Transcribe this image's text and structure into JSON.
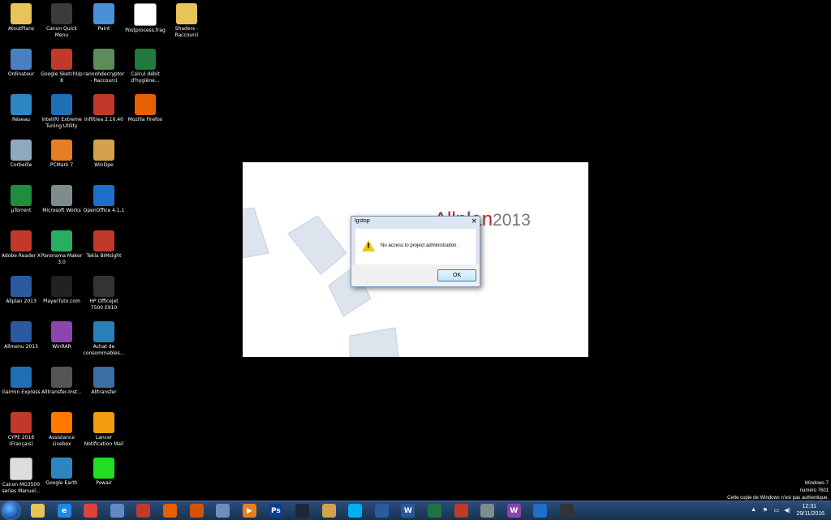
{
  "desktop": {
    "icons": [
      {
        "label": "AtoutPlans",
        "icon": "folder-icon",
        "color": "#e8c35a"
      },
      {
        "label": "Canon Quick Menu",
        "icon": "canon-icon",
        "color": "#3b3b3b"
      },
      {
        "label": "Paint",
        "icon": "paint-icon",
        "color": "#4a90d9"
      },
      {
        "label": "Postprocess.frag",
        "icon": "file-icon",
        "color": "#ffffff"
      },
      {
        "label": "Shaders - Raccourci",
        "icon": "folder-icon",
        "color": "#e8c35a"
      },
      {
        "label": "Ordinateur",
        "icon": "computer-icon",
        "color": "#4a7fc1"
      },
      {
        "label": "Google SketchUp 8",
        "icon": "sketchup-icon",
        "color": "#c0392b"
      },
      {
        "label": "rannohdecryptor - Raccourci",
        "icon": "app-icon",
        "color": "#5b8c5a"
      },
      {
        "label": "Calcul débit d'hygiène...",
        "icon": "excel-icon",
        "color": "#1f7a3b"
      },
      {
        "label": "Réseau",
        "icon": "network-icon",
        "color": "#2e86c1"
      },
      {
        "label": "Intel(R) Extreme Tuning Utility",
        "icon": "intel-icon",
        "color": "#1f6fb5"
      },
      {
        "label": "Infiltrea 2.10.40",
        "icon": "infiltrea-icon",
        "color": "#c0392b"
      },
      {
        "label": "Mozilla Firefox",
        "icon": "firefox-icon",
        "color": "#e66000"
      },
      {
        "label": "Corbeille",
        "icon": "recycle-bin-icon",
        "color": "#8fa7bf"
      },
      {
        "label": "PCMark 7",
        "icon": "pcmark-icon",
        "color": "#e67e22"
      },
      {
        "label": "WinDpe",
        "icon": "house-icon",
        "color": "#d4a24c"
      },
      {
        "label": "µTorrent",
        "icon": "utorrent-icon",
        "color": "#1e8e3e"
      },
      {
        "label": "Microsoft Works",
        "icon": "works-icon",
        "color": "#7f8c8d"
      },
      {
        "label": "OpenOffice 4.1.1",
        "icon": "openoffice-icon",
        "color": "#1e6fc9"
      },
      {
        "label": "Adobe Reader X",
        "icon": "adobe-icon",
        "color": "#c0392b"
      },
      {
        "label": "Panorama Maker 3.0",
        "icon": "panorama-icon",
        "color": "#27ae60"
      },
      {
        "label": "Tekla BIMsight",
        "icon": "tekla-icon",
        "color": "#c0392b"
      },
      {
        "label": "Allplan 2013",
        "icon": "allplan-icon",
        "color": "#2c5aa0"
      },
      {
        "label": "PlayerTuto.com",
        "icon": "player-icon",
        "color": "#222222"
      },
      {
        "label": "HP Officejet 7500 E910",
        "icon": "printer-icon",
        "color": "#333333"
      },
      {
        "label": "Allmenu 2013",
        "icon": "allmenu-icon",
        "color": "#2c5aa0"
      },
      {
        "label": "WinRAR",
        "icon": "winrar-icon",
        "color": "#8e44ad"
      },
      {
        "label": "Achat de consommables...",
        "icon": "shop-icon",
        "color": "#2980b9"
      },
      {
        "label": "Garmin Express",
        "icon": "garmin-icon",
        "color": "#1f6fb5"
      },
      {
        "label": "Alltransfer-Inst...",
        "icon": "laptop-icon",
        "color": "#555555"
      },
      {
        "label": "Alltransfer",
        "icon": "transfer-icon",
        "color": "#3b6ea5"
      },
      {
        "label": "CYPE 2016 (Français)",
        "icon": "cype-icon",
        "color": "#c0392b"
      },
      {
        "label": "Assistance Livebox",
        "icon": "livebox-icon",
        "color": "#ff7900"
      },
      {
        "label": "Lancer Notification Mail",
        "icon": "notification-icon",
        "color": "#f39c12"
      },
      {
        "label": "Canon MG3500 series Manuel...",
        "icon": "manual-icon",
        "color": "#dddddd"
      },
      {
        "label": "Google Earth",
        "icon": "google-earth-icon",
        "color": "#2e86c1"
      },
      {
        "label": "Powair",
        "icon": "powair-icon",
        "color": "#22dd22"
      }
    ]
  },
  "splash": {
    "logo_main": "Allplan",
    "logo_year": "2013"
  },
  "dialog": {
    "title": "lgstop",
    "close": "×",
    "message": "No access to project administration.",
    "ok_label": "OK"
  },
  "watermark": {
    "line1": "Windows 7",
    "line2": "numéro 7601",
    "line3": "Cette copie de Windows n'est pas authentique."
  },
  "taskbar": {
    "items": [
      {
        "icon": "explorer-icon",
        "color": "#e8c35a",
        "glyph": ""
      },
      {
        "icon": "internet-explorer-icon",
        "color": "#1e88e5",
        "glyph": "e"
      },
      {
        "icon": "chrome-icon",
        "color": "#db4437",
        "glyph": ""
      },
      {
        "icon": "mail-icon",
        "color": "#5d8ac4",
        "glyph": ""
      },
      {
        "icon": "antivirus-icon",
        "color": "#c0392b",
        "glyph": ""
      },
      {
        "icon": "firefox-icon",
        "color": "#e66000",
        "glyph": ""
      },
      {
        "icon": "paint-icon",
        "color": "#d35400",
        "glyph": ""
      },
      {
        "icon": "window-icon",
        "color": "#6c8ebf",
        "glyph": ""
      },
      {
        "icon": "media-player-icon",
        "color": "#e67e22",
        "glyph": "▶"
      },
      {
        "icon": "photoshop-icon",
        "color": "#0b3d91",
        "glyph": "Ps"
      },
      {
        "icon": "steam-icon",
        "color": "#1b2838",
        "glyph": ""
      },
      {
        "icon": "folder-icon",
        "color": "#d4a24c",
        "glyph": ""
      },
      {
        "icon": "skype-icon",
        "color": "#00aff0",
        "glyph": ""
      },
      {
        "icon": "app-icon",
        "color": "#2c5aa0",
        "glyph": ""
      },
      {
        "icon": "word-icon",
        "color": "#2b579a",
        "glyph": "W"
      },
      {
        "icon": "excel-icon",
        "color": "#217346",
        "glyph": ""
      },
      {
        "icon": "sketchup-icon",
        "color": "#c0392b",
        "glyph": ""
      },
      {
        "icon": "settings-icon",
        "color": "#7f8c8d",
        "glyph": ""
      },
      {
        "icon": "winrar-icon",
        "color": "#8e44ad",
        "glyph": "W"
      },
      {
        "icon": "openoffice-icon",
        "color": "#1e6fc9",
        "glyph": ""
      },
      {
        "icon": "printer-icon",
        "color": "#333333",
        "glyph": ""
      }
    ],
    "clock_time": "12:31",
    "clock_date": "29/11/2016"
  }
}
